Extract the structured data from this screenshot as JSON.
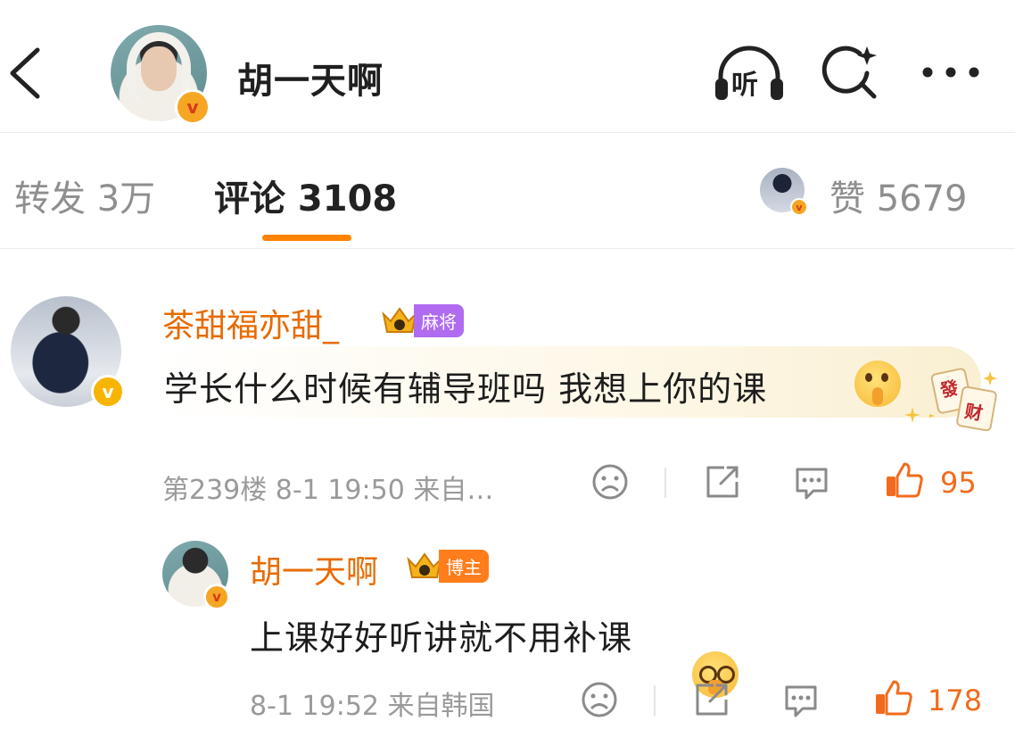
{
  "header": {
    "title": "胡一天啊",
    "listen_label": "听"
  },
  "tabs": [
    {
      "label": "转发 3万"
    },
    {
      "label": "评论 3108"
    }
  ],
  "likes_total": "赞 5679",
  "comment": {
    "username": "茶甜福亦甜_",
    "tag": "麻将",
    "text": "学长什么时候有辅导班吗 我想上你的课",
    "meta": "第239楼  8-1 19:50  来自…",
    "like_count": "95",
    "sticker_chars": [
      "發",
      "财"
    ]
  },
  "reply": {
    "username": "胡一天啊",
    "tag": "博主",
    "text": "上课好好听讲就不用补课",
    "meta": "8-1 19:52  来自韩国",
    "like_count": "178"
  },
  "colors": {
    "accent": "#ff8200",
    "username": "#e86b00",
    "like": "#f26b1d",
    "tag_majiang": "#b06bf0",
    "tag_bozhu": "#ff7d1a"
  }
}
